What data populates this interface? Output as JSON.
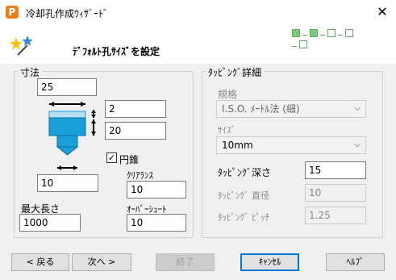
{
  "window": {
    "title": "冷却孔作成ｳｨｻﾞｰﾄﾞ",
    "app_icon_letter": "P"
  },
  "header": {
    "title": "ﾃﾞﾌｫﾙﾄ孔ｻｲｽﾞを設定"
  },
  "dimensions": {
    "group_label": "寸法",
    "top_width": "25",
    "field_right_1": "2",
    "field_right_2": "20",
    "bottom_width": "10",
    "cone_label": "円錐",
    "cone_checked": true,
    "clearance_label": "ｸﾘｱﾗﾝｽ",
    "clearance_value": "10",
    "max_length_label": "最大長さ",
    "max_length_value": "1000",
    "overshoot_label": "ｵｰﾊﾞｰｼｭｰﾄ",
    "overshoot_value": "10"
  },
  "tapping": {
    "group_label": "ﾀｯﾋﾟﾝｸﾞ詳細",
    "standard_label": "規格",
    "standard_value": "I.S.O. ﾒｰﾄﾙ法 (細)",
    "size_label": "ｻｲｽﾞ",
    "size_value": "10mm",
    "depth_label": "ﾀｯﾋﾟﾝｸﾞ深さ",
    "depth_value": "15",
    "diameter_label": "ﾀｯﾋﾟﾝｸﾞ 直径",
    "diameter_value": "10",
    "pitch_label": "ﾀｯﾋﾟﾝｸﾞ ﾋﾟｯﾁ",
    "pitch_value": "1.25"
  },
  "buttons": {
    "back": "< 戻る",
    "next": "次へ >",
    "finish": "終了",
    "cancel": "ｷｬﾝｾﾙ",
    "help": "ﾍﾙﾌﾟ"
  },
  "colors": {
    "accent": "#0078d7",
    "icon": "#e8811a",
    "drawing": "#1a9fd8"
  }
}
